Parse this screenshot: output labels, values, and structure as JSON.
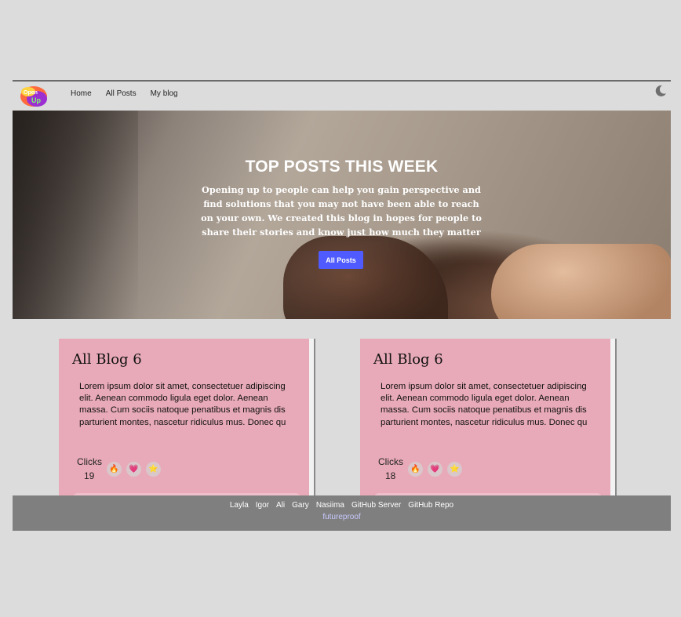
{
  "nav": {
    "logo_text_top": "Open",
    "logo_text_bottom": "Up",
    "links": [
      "Home",
      "All Posts",
      "My blog"
    ]
  },
  "hero": {
    "title": "TOP POSTS THIS WEEK",
    "text": "Opening up to people can help you gain perspective and find solutions that you may not have been able to reach on your own. We created this blog in hopes for people to share their stories and know just how much they matter",
    "button_label": "All Posts"
  },
  "cards": [
    {
      "title": "All Blog 6",
      "body": "Lorem ipsum dolor sit amet, consectetuer adipiscing elit. Aenean commodo ligula eget dolor. Aenean massa. Cum sociis natoque penatibus et magnis dis parturient montes, nascetur ridiculus mus. Donec qu",
      "clicks_label": "Clicks",
      "clicks": "19",
      "reactions": [
        "🔥",
        "💗",
        "⭐"
      ]
    },
    {
      "title": "All Blog 6",
      "body": "Lorem ipsum dolor sit amet, consectetuer adipiscing elit. Aenean commodo ligula eget dolor. Aenean massa. Cum sociis natoque penatibus et magnis dis parturient montes, nascetur ridiculus mus. Donec qu",
      "clicks_label": "Clicks",
      "clicks": "18",
      "reactions": [
        "🔥",
        "💗",
        "⭐"
      ]
    }
  ],
  "footer": {
    "links": [
      "Layla",
      "Igor",
      "Ali",
      "Gary",
      "Nasiima",
      "GitHub Server",
      "GitHub Repo"
    ],
    "brand": "futureproof"
  },
  "colors": {
    "accent_button": "#4f5bff",
    "card_background": "#e8aab8",
    "footer_background": "#7f7f7f"
  }
}
